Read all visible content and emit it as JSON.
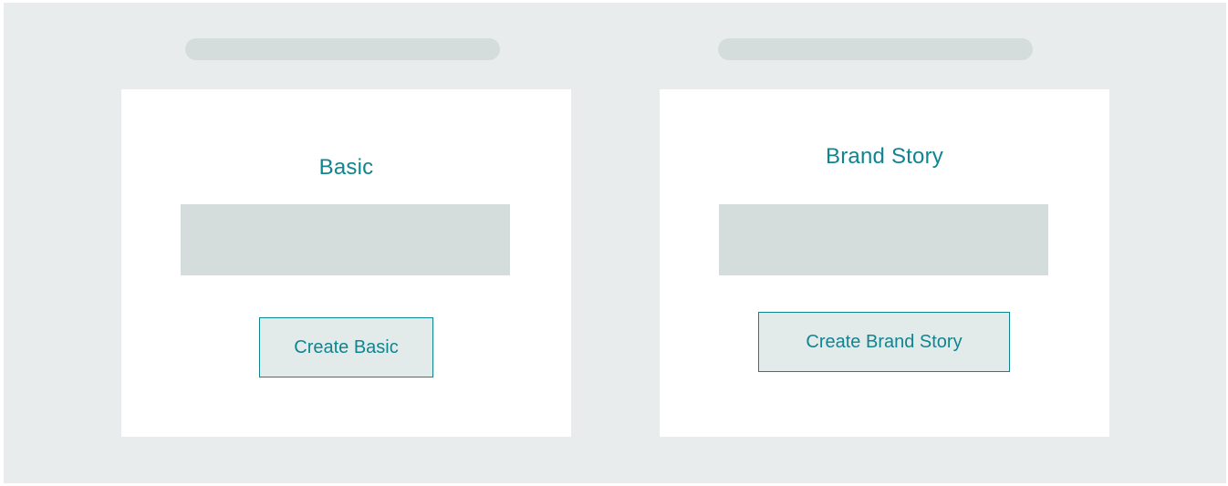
{
  "colors": {
    "background": "#e8ecec",
    "card": "#ffffff",
    "placeholder": "#d5dcdc",
    "accent": "#0f8590",
    "button_fill": "#e3eaea"
  },
  "cards": [
    {
      "title": "Basic",
      "button_label": "Create Basic"
    },
    {
      "title": "Brand Story",
      "button_label": "Create Brand Story"
    }
  ]
}
